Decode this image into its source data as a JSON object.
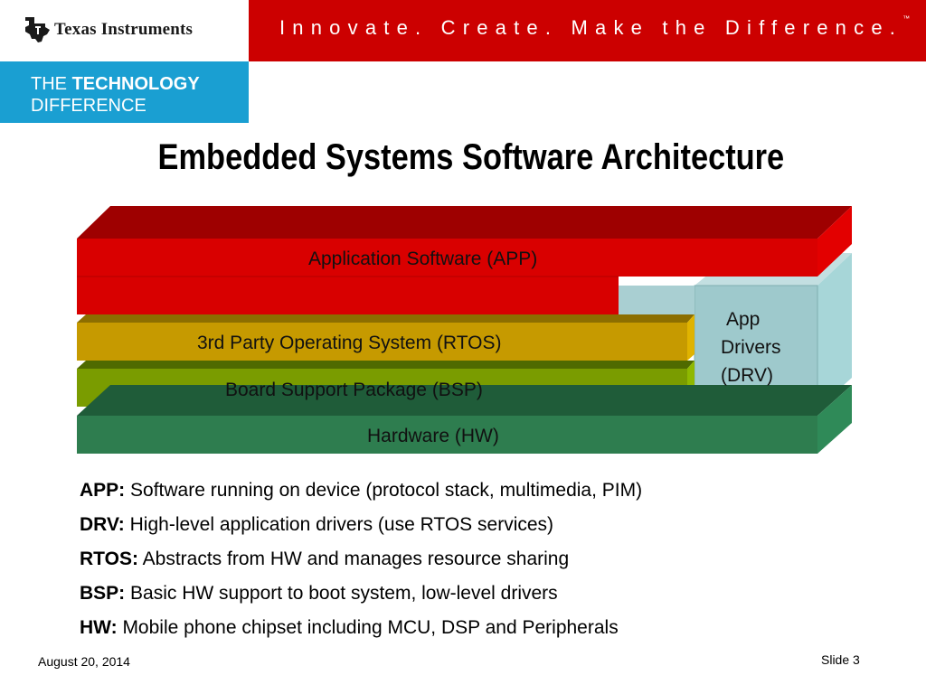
{
  "header": {
    "brand": "Texas Instruments",
    "tagline": "Innovate. Create. Make the Difference.",
    "tagline_mark": "™",
    "logo_icon": "ti-state-logo-icon",
    "brand_red": "#cc0000",
    "brand_blue": "#1a9fd2"
  },
  "banner": {
    "line1_prefix": "THE",
    "line1_bold": "TECHNOLOGY",
    "line2": "DIFFERENCE"
  },
  "slide": {
    "title": "Embedded Systems Software Architecture"
  },
  "layers": {
    "app": {
      "label": "Application Software (APP)",
      "color": "#dd0000"
    },
    "rtos": {
      "label": "3rd Party Operating System (RTOS)",
      "color": "#c69a00"
    },
    "bsp": {
      "label": "Board Support Package (BSP)",
      "color": "#7a9c00"
    },
    "drv": {
      "label_line1": "App",
      "label_line2": "Drivers",
      "label_line3": "(DRV)",
      "color": "#9ec9cc"
    },
    "hw": {
      "label": "Hardware (HW)",
      "color": "#2e7d4f"
    }
  },
  "definitions": [
    {
      "term": "APP:",
      "text": " Software running on device (protocol stack, multimedia, PIM)"
    },
    {
      "term": "DRV:",
      "text": " High-level application drivers (use RTOS services)"
    },
    {
      "term": "RTOS:",
      "text": " Abstracts from HW and manages resource sharing"
    },
    {
      "term": "BSP:",
      "text": " Basic HW support to boot system, low-level drivers"
    },
    {
      "term": "HW:",
      "text": " Mobile phone chipset including MCU, DSP and Peripherals"
    }
  ],
  "footer": {
    "date": "August 20, 2014",
    "slide": "Slide 3"
  }
}
